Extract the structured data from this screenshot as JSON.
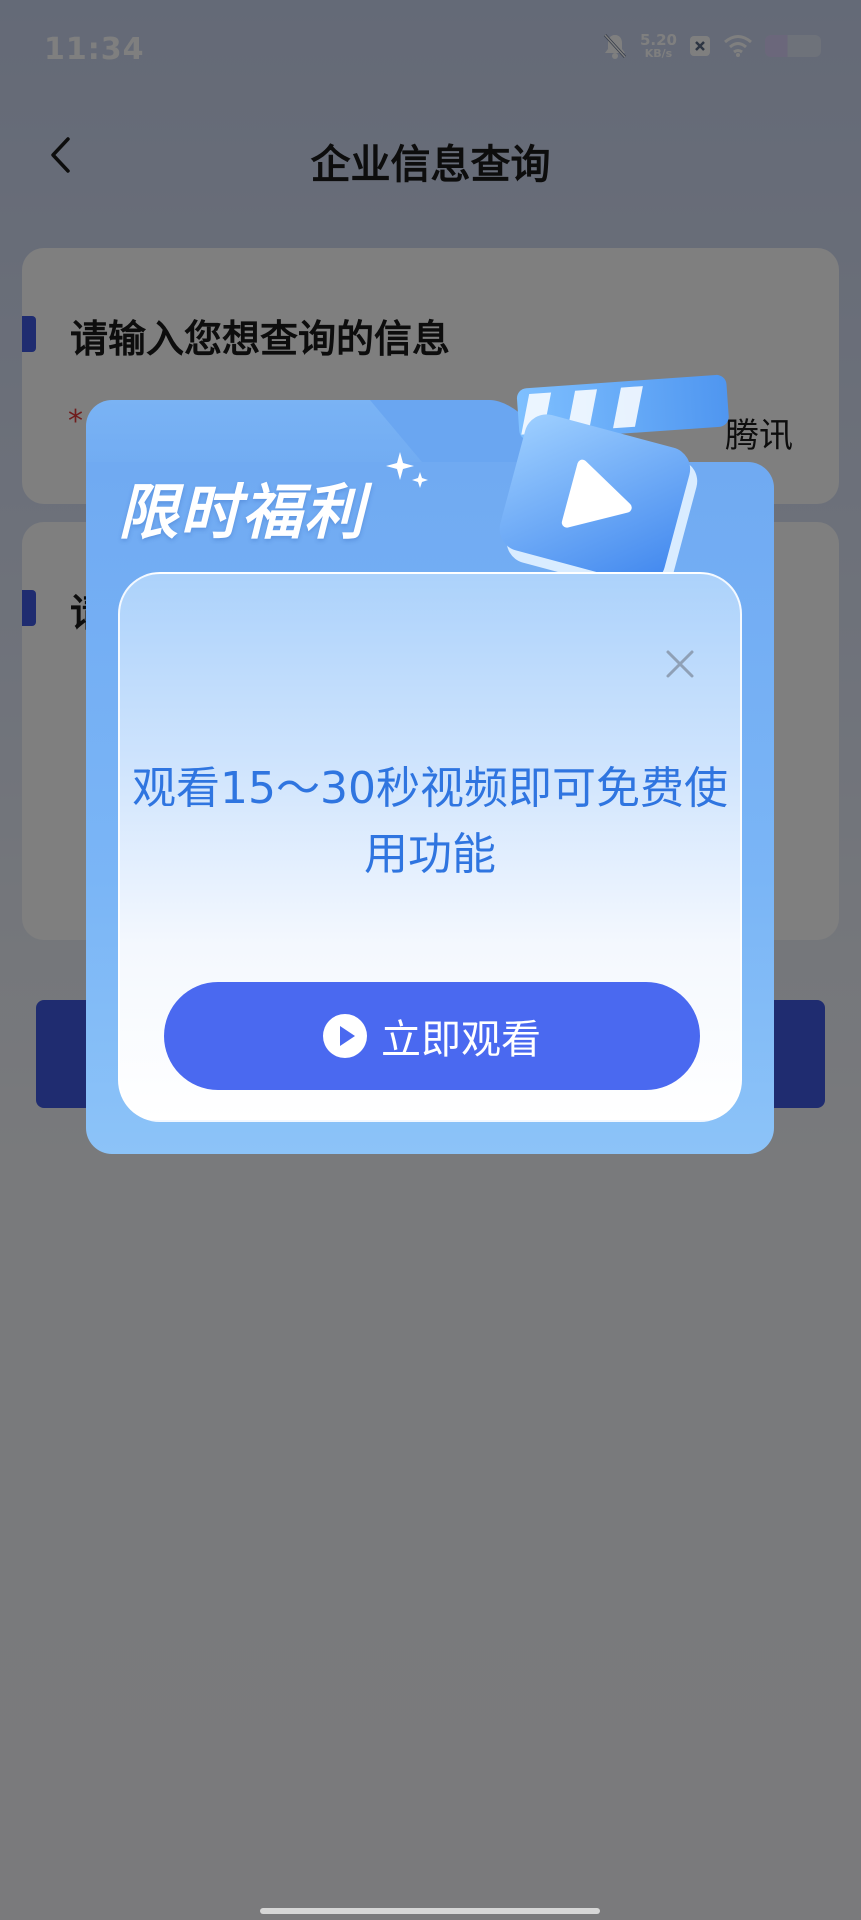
{
  "status_bar": {
    "time": "11:34",
    "net_speed_value": "5.20",
    "net_speed_unit": "KB/s",
    "icons": [
      "bell-muted-icon",
      "x-badge-icon",
      "wifi-icon",
      "battery-icon"
    ]
  },
  "header": {
    "back_icon": "chevron-left-icon",
    "title": "企业信息查询"
  },
  "form": {
    "section1_title": "请输入您想查询的信息",
    "required_mark": "*",
    "company_value": "腾讯",
    "section2_title_partial": "请"
  },
  "popup": {
    "title": "限时福利",
    "message": "观看15～30秒视频即可免费使用功能",
    "watch_button_label": "立即观看",
    "close_icon": "close-icon",
    "play_icon": "play-circle-icon"
  },
  "colors": {
    "accent": "#3e58e0",
    "popup_blue": "#6aa6f1",
    "message_blue": "#2f75e0",
    "button_blue": "#4a69f0"
  }
}
